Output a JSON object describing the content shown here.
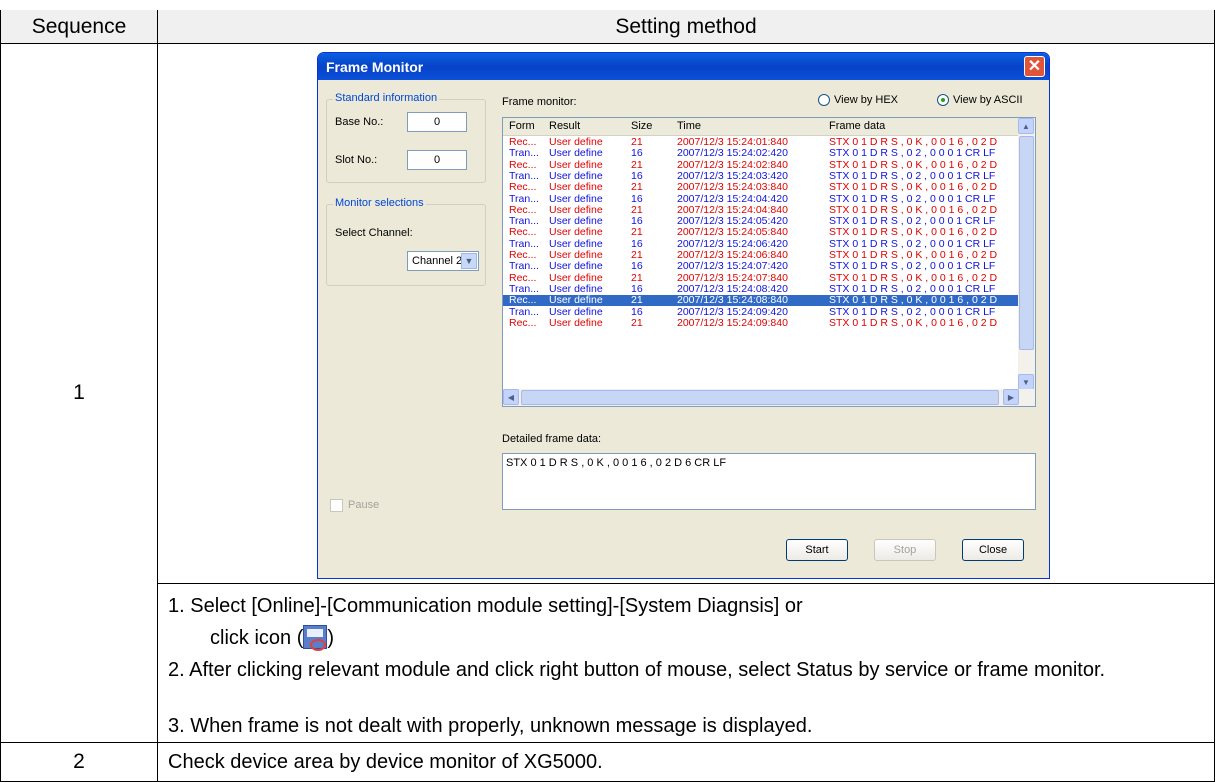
{
  "table": {
    "header_sequence": "Sequence",
    "header_method": "Setting method",
    "row1_seq": "1",
    "row2_seq": "2",
    "row2_text": "Check device area by device monitor of XG5000.",
    "steps": [
      "1. Select [Online]-[Communication module setting]-[System Diagnsis] or",
      "click icon (",
      ")",
      "2. After clicking relevant module and click right button of mouse, select Status by service or frame monitor.",
      "3. When frame is not dealt with properly, unknown message is displayed."
    ]
  },
  "window": {
    "title": "Frame Monitor",
    "std_group": "Standard information",
    "base_label": "Base No.:",
    "base_value": "0",
    "slot_label": "Slot No.:",
    "slot_value": "0",
    "mon_group": "Monitor selections",
    "channel_label": "Select Channel:",
    "channel_value": "Channel 2",
    "frame_monitor_label": "Frame monitor:",
    "view_hex": "View by HEX",
    "view_ascii": "View by ASCII",
    "columns": [
      "Form",
      "Result",
      "Size",
      "Time",
      "Frame data"
    ],
    "rows": [
      [
        "Rec...",
        "User define",
        "21",
        "2007/12/3 15:24:01:840",
        "STX 0 1 D R S , 0 K , 0 0 1 6 , 0 2 D",
        "red"
      ],
      [
        "Tran...",
        "User define",
        "16",
        "2007/12/3 15:24:02:420",
        "STX 0 1 D R S , 0 2 , 0 0 0 1 CR LF",
        "blue"
      ],
      [
        "Rec...",
        "User define",
        "21",
        "2007/12/3 15:24:02:840",
        "STX 0 1 D R S , 0 K , 0 0 1 6 , 0 2 D",
        "red"
      ],
      [
        "Tran...",
        "User define",
        "16",
        "2007/12/3 15:24:03:420",
        "STX 0 1 D R S , 0 2 , 0 0 0 1 CR LF",
        "blue"
      ],
      [
        "Rec...",
        "User define",
        "21",
        "2007/12/3 15:24:03:840",
        "STX 0 1 D R S , 0 K , 0 0 1 6 , 0 2 D",
        "red"
      ],
      [
        "Tran...",
        "User define",
        "16",
        "2007/12/3 15:24:04:420",
        "STX 0 1 D R S , 0 2 , 0 0 0 1 CR LF",
        "blue"
      ],
      [
        "Rec...",
        "User define",
        "21",
        "2007/12/3 15:24:04:840",
        "STX 0 1 D R S , 0 K , 0 0 1 6 , 0 2 D",
        "red"
      ],
      [
        "Tran...",
        "User define",
        "16",
        "2007/12/3 15:24:05:420",
        "STX 0 1 D R S , 0 2 , 0 0 0 1 CR LF",
        "blue"
      ],
      [
        "Rec...",
        "User define",
        "21",
        "2007/12/3 15:24:05:840",
        "STX 0 1 D R S , 0 K , 0 0 1 6 , 0 2 D",
        "red"
      ],
      [
        "Tran...",
        "User define",
        "16",
        "2007/12/3 15:24:06:420",
        "STX 0 1 D R S , 0 2 , 0 0 0 1 CR LF",
        "blue"
      ],
      [
        "Rec...",
        "User define",
        "21",
        "2007/12/3 15:24:06:840",
        "STX 0 1 D R S , 0 K , 0 0 1 6 , 0 2 D",
        "red"
      ],
      [
        "Tran...",
        "User define",
        "16",
        "2007/12/3 15:24:07:420",
        "STX 0 1 D R S , 0 2 , 0 0 0 1 CR LF",
        "blue"
      ],
      [
        "Rec...",
        "User define",
        "21",
        "2007/12/3 15:24:07:840",
        "STX 0 1 D R S , 0 K , 0 0 1 6 , 0 2 D",
        "red"
      ],
      [
        "Tran...",
        "User define",
        "16",
        "2007/12/3 15:24:08:420",
        "STX 0 1 D R S , 0 2 , 0 0 0 1 CR LF",
        "blue"
      ],
      [
        "Rec...",
        "User define",
        "21",
        "2007/12/3 15:24:08:840",
        "STX 0 1 D R S , 0 K , 0 0 1 6 , 0 2 D",
        "sel"
      ],
      [
        "Tran...",
        "User define",
        "16",
        "2007/12/3 15:24:09:420",
        "STX 0 1 D R S , 0 2 , 0 0 0 1 CR LF",
        "blue"
      ],
      [
        "Rec...",
        "User define",
        "21",
        "2007/12/3 15:24:09:840",
        "STX 0 1 D R S , 0 K , 0 0 1 6 , 0 2 D",
        "red"
      ]
    ],
    "detail_label": "Detailed frame data:",
    "detail_value": "STX 0 1 D R S , 0 K , 0 0 1 6 , 0 2 D 6 CR LF",
    "pause_label": "Pause",
    "start_label": "Start",
    "stop_label": "Stop",
    "close_label": "Close"
  }
}
